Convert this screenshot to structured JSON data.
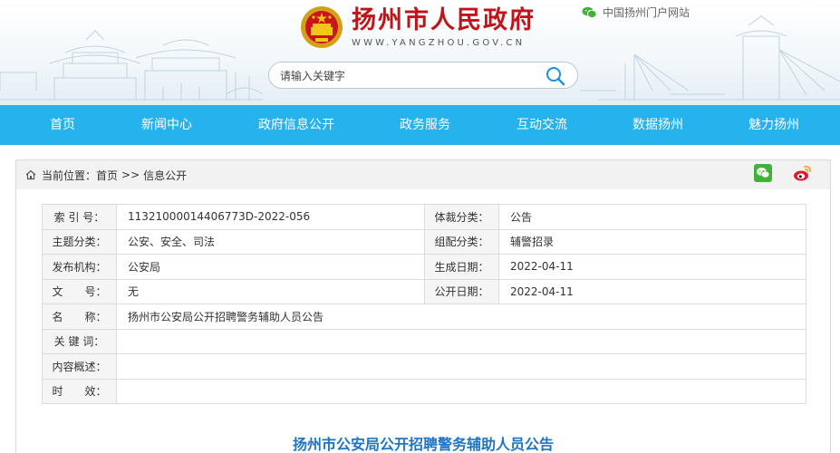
{
  "header": {
    "site_title": "扬州市人民政府",
    "site_domain": "WWW.YANGZHOU.GOV.CN",
    "portal_link": "中国扬州门户网站",
    "emblem_icon": "national-emblem-icon",
    "search": {
      "placeholder": "请输入关键字",
      "value": ""
    }
  },
  "nav": {
    "items": [
      "首页",
      "新闻中心",
      "政府信息公开",
      "政务服务",
      "互动交流",
      "数据扬州",
      "魅力扬州"
    ],
    "color": "#26b2ec"
  },
  "breadcrumb": {
    "prefix": "当前位置：",
    "items": [
      "首页",
      "信息公开"
    ],
    "separator": ">>"
  },
  "share": {
    "wechat_icon": "wechat-icon",
    "weibo_icon": "weibo-icon"
  },
  "info": {
    "index_label": "索 引 号：",
    "index_value": "11321000014406773D-2022-056",
    "genre_label": "体裁分类：",
    "genre_value": "公告",
    "topic_label": "主题分类：",
    "topic_value": "公安、安全、司法",
    "group_label": "组配分类：",
    "group_value": "辅警招录",
    "issuer_label": "发布机构：",
    "issuer_value": "公安局",
    "created_label": "生成日期：",
    "created_value": "2022-04-11",
    "docno_label": "文　　号：",
    "docno_value": "无",
    "published_label": "公开日期：",
    "published_value": "2022-04-11",
    "name_label": "名　　称：",
    "name_value": "扬州市公安局公开招聘警务辅助人员公告",
    "keywords_label": "关 键 词：",
    "keywords_value": "",
    "summary_label": "内容概述：",
    "summary_value": "",
    "validity_label": "时　　效：",
    "validity_value": ""
  },
  "article": {
    "title": "扬州市公安局公开招聘警务辅助人员公告",
    "title_color": "#1f74c4"
  }
}
